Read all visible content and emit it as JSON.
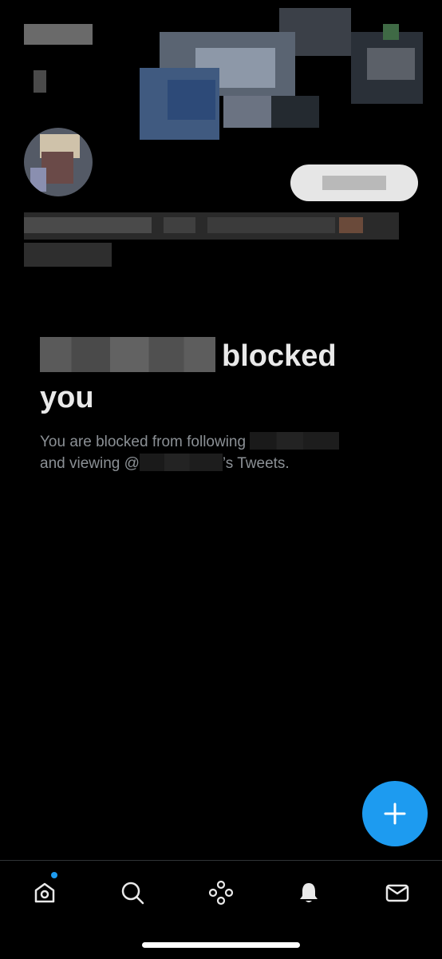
{
  "profile": {
    "blocked_title_suffix": "blocked",
    "blocked_title_line2": "you",
    "desc_part1": "You are blocked from following",
    "desc_part2": "and viewing @",
    "desc_part3": "’s Tweets."
  },
  "fab": {
    "icon": "plus-icon"
  },
  "tabbar": {
    "items": [
      {
        "name": "home",
        "icon": "home-icon",
        "has_badge": true
      },
      {
        "name": "search",
        "icon": "search-icon"
      },
      {
        "name": "spaces",
        "icon": "spaces-icon"
      },
      {
        "name": "notifications",
        "icon": "bell-icon"
      },
      {
        "name": "messages",
        "icon": "mail-icon"
      }
    ]
  },
  "colors": {
    "background": "#000000",
    "accent": "#1d9bf0",
    "text_primary": "#e9e9e9",
    "text_secondary": "#8b9095",
    "divider": "#2f3336"
  }
}
